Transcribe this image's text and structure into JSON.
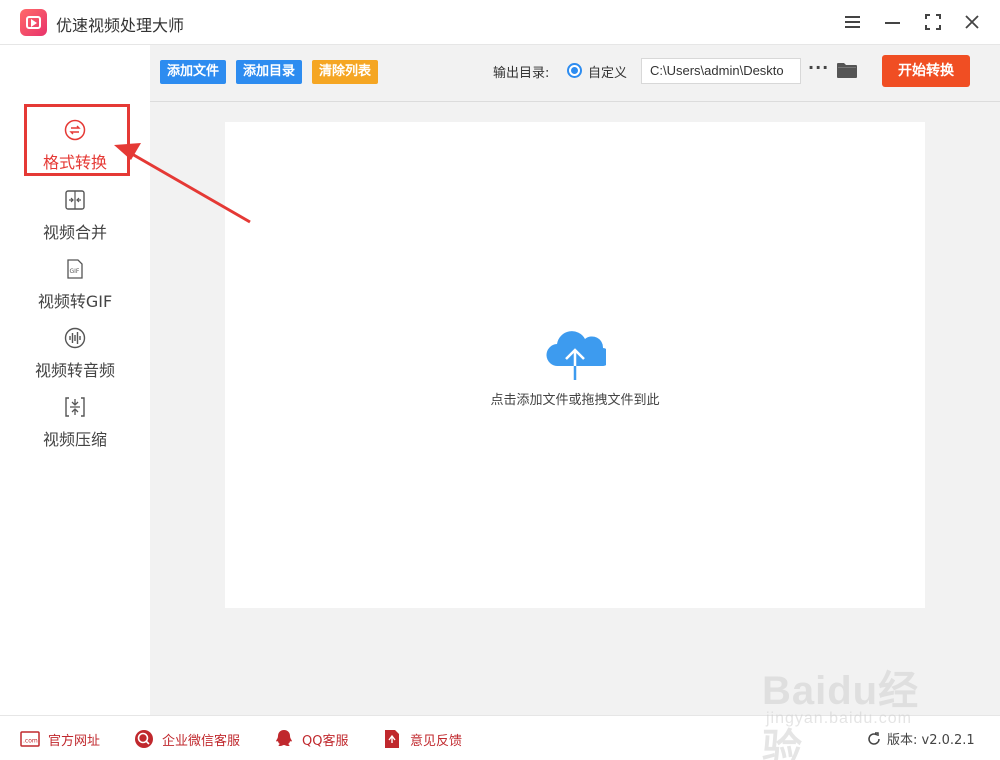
{
  "window": {
    "title": "优速视频处理大师",
    "controls": [
      "menu-icon",
      "minimize-icon",
      "maximize-icon",
      "close-icon"
    ]
  },
  "sidebar": {
    "items": [
      {
        "label": "格式转换",
        "icon": "format-convert-icon",
        "active": true
      },
      {
        "label": "视频合并",
        "icon": "video-merge-icon",
        "active": false
      },
      {
        "label": "视频转GIF",
        "icon": "gif-icon",
        "active": false
      },
      {
        "label": "视频转音频",
        "icon": "audio-wave-icon",
        "active": false
      },
      {
        "label": "视频压缩",
        "icon": "compress-icon",
        "active": false
      }
    ]
  },
  "toolbar": {
    "add_file": "添加文件",
    "add_dir": "添加目录",
    "clear_list": "清除列表",
    "output_label": "输出目录:",
    "radio_label": "自定义",
    "output_path": "C:\\Users\\admin\\Deskto",
    "more": "···",
    "start": "开始转换"
  },
  "main": {
    "drop_hint": "点击添加文件或拖拽文件到此"
  },
  "footer": {
    "website": "官方网址",
    "wechat": "企业微信客服",
    "qq": "QQ客服",
    "feedback": "意见反馈",
    "version": "版本: v2.0.2.1"
  },
  "watermark": {
    "text": "Baidu经验",
    "sub": "jingyan.baidu.com"
  },
  "colors": {
    "accent_blue": "#2d8cf0",
    "accent_orange": "#f5a623",
    "start_red": "#f04e23",
    "active_red": "#e53935",
    "cloud_blue": "#3d9bef"
  }
}
